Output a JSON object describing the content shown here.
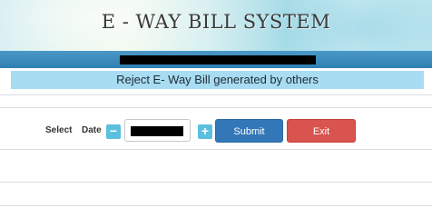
{
  "header": {
    "title": "E - WAY BILL SYSTEM"
  },
  "page": {
    "heading": "Reject E- Way Bill generated by others"
  },
  "form": {
    "select_label": "Select",
    "date_label": "Date",
    "decrement_symbol": "−",
    "increment_symbol": "+",
    "submit_label": "Submit",
    "exit_label": "Exit"
  },
  "colors": {
    "nav_bar": "#2f7fb3",
    "banner_bg": "#a8dcf2",
    "stepper": "#5bc0de",
    "submit": "#3377b8",
    "exit": "#d9534f"
  }
}
